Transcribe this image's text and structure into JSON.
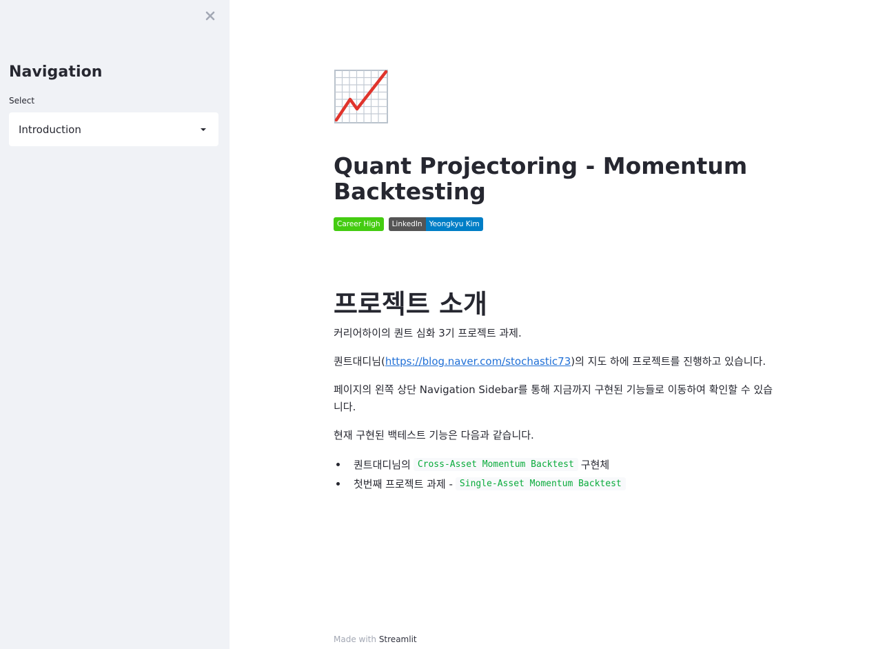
{
  "sidebar": {
    "title": "Navigation",
    "select_label": "Select",
    "selected": "Introduction"
  },
  "main": {
    "title": "Quant Projectoring - Momentum Backtesting",
    "badges": [
      {
        "label": "Career High",
        "color": "#44cc11"
      },
      {
        "left": "LinkedIn",
        "right": "Yeongkyu Kim",
        "left_color": "#555555",
        "right_color": "#007ec6"
      }
    ],
    "section_title": "프로젝트 소개",
    "p1": "커리어하이의 퀀트 심화 3기 프로젝트 과제.",
    "p2_before": "퀀트대디님(",
    "p2_link": "https://blog.naver.com/stochastic73",
    "p2_after": ")의 지도 하에 프로젝트를 진행하고 있습니다.",
    "p3_line1": "페이지의 왼쪽 상단 Navigation Sidebar를 통해 지금까지 구현된 기능들로 이동하여 확인할 수 있습",
    "p3_line2": "니다.",
    "p4": "현재 구현된 백테스트 기능은 다음과 같습니다.",
    "bullets": [
      {
        "before": "퀀트대디님의",
        "code": "Cross-Asset Momentum Backtest",
        "after": "구현체"
      },
      {
        "before": "첫번째 프로젝트 과제 -",
        "code": "Single-Asset Momentum Backtest",
        "after": ""
      }
    ]
  },
  "footer": {
    "prefix": "Made with",
    "brand": "Streamlit"
  },
  "icons": {
    "close": "close-icon",
    "caret": "caret-down-icon",
    "hero": "chart-increasing-icon"
  },
  "colors": {
    "sidebar_bg": "#f0f2f6",
    "code_text": "#09ab3b",
    "link": "#1f6fd6"
  }
}
